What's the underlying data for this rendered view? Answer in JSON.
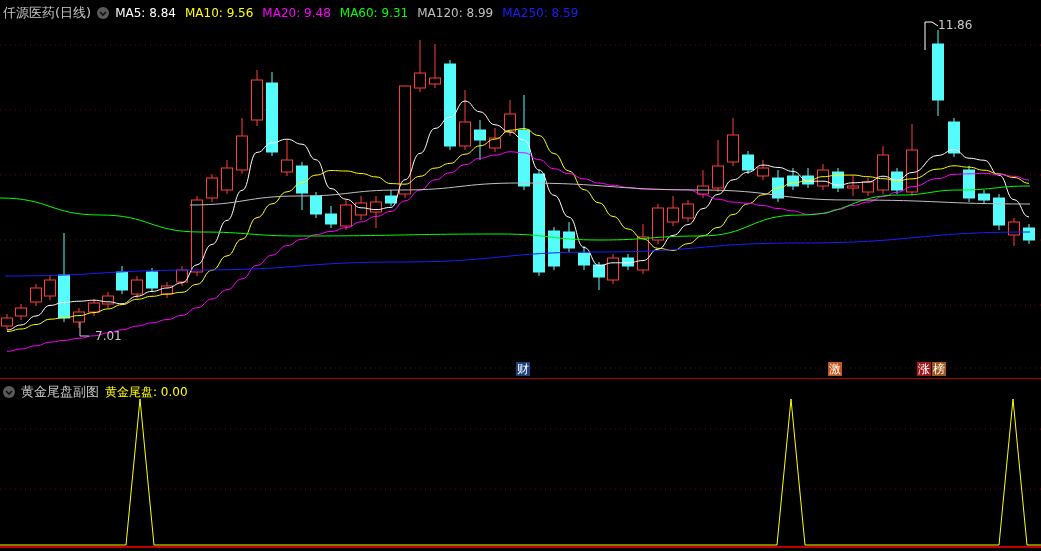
{
  "main_pane": {
    "title": "仟源医药(日线)",
    "ma_legend": [
      {
        "label": "MA5:",
        "value": "8.84",
        "color": "#ffffff"
      },
      {
        "label": "MA10:",
        "value": "9.56",
        "color": "#ffff00"
      },
      {
        "label": "MA20:",
        "value": "9.48",
        "color": "#ff00ff"
      },
      {
        "label": "MA60:",
        "value": "9.31",
        "color": "#00ff00"
      },
      {
        "label": "MA120:",
        "value": "8.99",
        "color": "#c0c0c0"
      },
      {
        "label": "MA250:",
        "value": "8.59",
        "color": "#1c1cff"
      }
    ],
    "high_label": "11.86",
    "low_label": "7.01",
    "event_tags": [
      {
        "text": "财",
        "color": "#1a3f7a"
      },
      {
        "text": "激",
        "color": "#c4561c"
      },
      {
        "text": "涨",
        "color": "#a3161c"
      },
      {
        "text": "榜",
        "color": "#a0561a"
      }
    ]
  },
  "sub_pane": {
    "title": "黄金尾盘副图",
    "indicator": "黄金尾盘:",
    "value": "0.00"
  }
}
